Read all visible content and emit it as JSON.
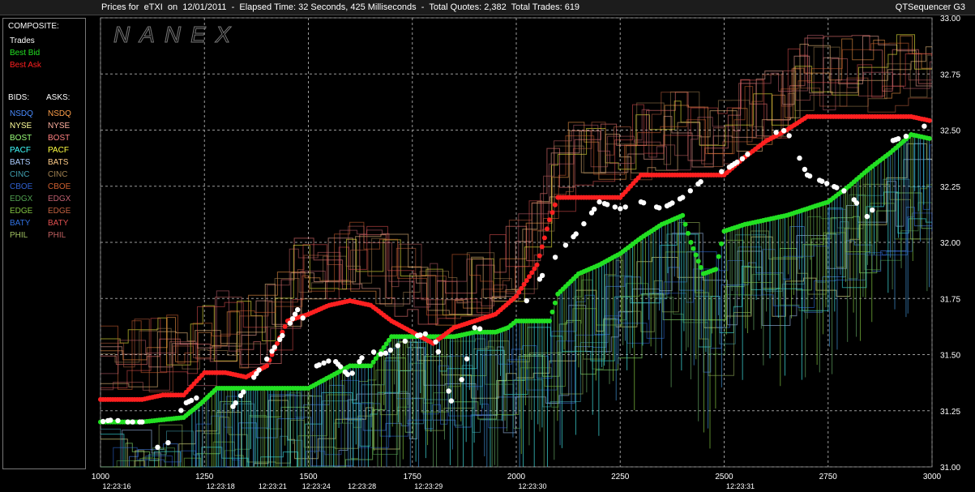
{
  "title": {
    "left": "Prices for  eTXI  on  12/01/2011  -  Elapsed Time: 32 Seconds, 425 Milliseconds  -  Total Quotes: 2,382  Total Trades: 619",
    "right": "QTSequencer G3"
  },
  "watermark": "NANEX",
  "legend": {
    "composite_header": "COMPOSITE:",
    "composite": [
      {
        "label": "Trades",
        "color": "#ffffff"
      },
      {
        "label": "Best Bid",
        "color": "#22e022"
      },
      {
        "label": "Best Ask",
        "color": "#ff2020"
      }
    ],
    "bids_header": "BIDS:",
    "asks_header": "ASKS:",
    "exchanges": [
      {
        "bid": "NSDQ",
        "ask": "NSDQ",
        "bid_color": "#4a8cff",
        "ask_color": "#ff9f4a"
      },
      {
        "bid": "NYSE",
        "ask": "NYSE",
        "bid_color": "#ffff9a",
        "ask_color": "#ffb0a0"
      },
      {
        "bid": "BOST",
        "ask": "BOST",
        "bid_color": "#9aff7a",
        "ask_color": "#ff8080"
      },
      {
        "bid": "PACF",
        "ask": "PACF",
        "bid_color": "#40ffff",
        "ask_color": "#ffff40"
      },
      {
        "bid": "BATS",
        "ask": "BATS",
        "bid_color": "#aaccff",
        "ask_color": "#ffcc88"
      },
      {
        "bid": "CINC",
        "ask": "CINC",
        "bid_color": "#40a0b0",
        "ask_color": "#a08050"
      },
      {
        "bid": "CBOE",
        "ask": "CBOE",
        "bid_color": "#3060d0",
        "ask_color": "#d06030"
      },
      {
        "bid": "EDGX",
        "ask": "EDGX",
        "bid_color": "#50a050",
        "ask_color": "#c06070"
      },
      {
        "bid": "EDGE",
        "ask": "EDGE",
        "bid_color": "#80c040",
        "ask_color": "#c06040"
      },
      {
        "bid": "BATY",
        "ask": "BATY",
        "bid_color": "#3070e0",
        "ask_color": "#e05050"
      },
      {
        "bid": "PHIL",
        "ask": "PHIL",
        "bid_color": "#a0c060",
        "ask_color": "#c06060"
      }
    ]
  },
  "chart_data": {
    "type": "scatter",
    "xlim": [
      1000,
      3000
    ],
    "ylim": [
      31.0,
      33.0
    ],
    "x_ticks": [
      1000,
      1250,
      1500,
      1750,
      2000,
      2250,
      2500,
      2750,
      3000
    ],
    "y_ticks": [
      31.0,
      31.25,
      31.5,
      31.75,
      32.0,
      32.25,
      32.5,
      32.75,
      33.0
    ],
    "y_tick_labels": [
      "31.00",
      "31.25",
      "31.50",
      "31.75",
      "32.00",
      "32.25",
      "32.50",
      "32.75",
      "33.00"
    ],
    "time_labels": [
      {
        "x": 1000,
        "label": "12:23:16"
      },
      {
        "x": 1250,
        "label": "12:23:18"
      },
      {
        "x": 1375,
        "label": "12:23:21"
      },
      {
        "x": 1480,
        "label": "12:23:24"
      },
      {
        "x": 1590,
        "label": "12:23:28"
      },
      {
        "x": 1750,
        "label": "12:23:29"
      },
      {
        "x": 2000,
        "label": "12:23:30"
      },
      {
        "x": 2500,
        "label": "12:23:31"
      }
    ],
    "grid": true,
    "series": [
      {
        "name": "Best Bid",
        "color": "#22e022",
        "points": [
          [
            1000,
            31.2
          ],
          [
            1100,
            31.2
          ],
          [
            1200,
            31.22
          ],
          [
            1240,
            31.28
          ],
          [
            1280,
            31.35
          ],
          [
            1350,
            31.35
          ],
          [
            1400,
            31.35
          ],
          [
            1450,
            31.35
          ],
          [
            1500,
            31.35
          ],
          [
            1550,
            31.4
          ],
          [
            1600,
            31.45
          ],
          [
            1650,
            31.45
          ],
          [
            1700,
            31.58
          ],
          [
            1750,
            31.58
          ],
          [
            1800,
            31.58
          ],
          [
            1850,
            31.58
          ],
          [
            1900,
            31.6
          ],
          [
            1950,
            31.6
          ],
          [
            1980,
            31.62
          ],
          [
            2000,
            31.65
          ],
          [
            2050,
            31.65
          ],
          [
            2080,
            31.65
          ],
          [
            2100,
            31.77
          ],
          [
            2150,
            31.86
          ],
          [
            2200,
            31.9
          ],
          [
            2250,
            31.95
          ],
          [
            2300,
            32.02
          ],
          [
            2350,
            32.08
          ],
          [
            2400,
            32.12
          ],
          [
            2420,
            32.0
          ],
          [
            2450,
            31.86
          ],
          [
            2480,
            31.88
          ],
          [
            2500,
            32.05
          ],
          [
            2550,
            32.08
          ],
          [
            2600,
            32.1
          ],
          [
            2650,
            32.12
          ],
          [
            2700,
            32.15
          ],
          [
            2750,
            32.18
          ],
          [
            2800,
            32.25
          ],
          [
            2850,
            32.33
          ],
          [
            2900,
            32.4
          ],
          [
            2950,
            32.48
          ],
          [
            3000,
            32.46
          ]
        ]
      },
      {
        "name": "Best Ask",
        "color": "#ff2020",
        "points": [
          [
            1000,
            31.3
          ],
          [
            1100,
            31.3
          ],
          [
            1150,
            31.32
          ],
          [
            1200,
            31.32
          ],
          [
            1250,
            31.42
          ],
          [
            1300,
            31.42
          ],
          [
            1350,
            31.4
          ],
          [
            1400,
            31.45
          ],
          [
            1450,
            31.65
          ],
          [
            1500,
            31.68
          ],
          [
            1550,
            31.72
          ],
          [
            1600,
            31.74
          ],
          [
            1650,
            31.72
          ],
          [
            1700,
            31.65
          ],
          [
            1750,
            31.6
          ],
          [
            1800,
            31.55
          ],
          [
            1850,
            31.62
          ],
          [
            1900,
            31.65
          ],
          [
            1950,
            31.68
          ],
          [
            2000,
            31.76
          ],
          [
            2050,
            31.9
          ],
          [
            2080,
            32.1
          ],
          [
            2100,
            32.2
          ],
          [
            2150,
            32.2
          ],
          [
            2200,
            32.2
          ],
          [
            2250,
            32.2
          ],
          [
            2300,
            32.3
          ],
          [
            2350,
            32.3
          ],
          [
            2400,
            32.3
          ],
          [
            2450,
            32.3
          ],
          [
            2500,
            32.3
          ],
          [
            2550,
            32.38
          ],
          [
            2600,
            32.45
          ],
          [
            2650,
            32.5
          ],
          [
            2700,
            32.56
          ],
          [
            2750,
            32.56
          ],
          [
            2800,
            32.56
          ],
          [
            2850,
            32.56
          ],
          [
            2900,
            32.56
          ],
          [
            2950,
            32.56
          ],
          [
            3000,
            32.54
          ]
        ]
      },
      {
        "name": "Trades",
        "color": "#ffffff",
        "points": [
          [
            1000,
            31.2
          ],
          [
            1030,
            31.21
          ],
          [
            1060,
            31.2
          ],
          [
            1100,
            31.2
          ],
          [
            1150,
            31.05
          ],
          [
            1200,
            31.28
          ],
          [
            1280,
            31.35
          ],
          [
            1300,
            31.22
          ],
          [
            1350,
            31.35
          ],
          [
            1400,
            31.48
          ],
          [
            1450,
            31.62
          ],
          [
            1480,
            31.72
          ],
          [
            1500,
            31.55
          ],
          [
            1520,
            31.45
          ],
          [
            1560,
            31.48
          ],
          [
            1600,
            31.4
          ],
          [
            1640,
            31.52
          ],
          [
            1680,
            31.5
          ],
          [
            1750,
            31.58
          ],
          [
            1800,
            31.6
          ],
          [
            1850,
            31.25
          ],
          [
            1900,
            31.62
          ],
          [
            1950,
            31.6
          ],
          [
            2000,
            31.66
          ],
          [
            2050,
            31.82
          ],
          [
            2100,
            31.95
          ],
          [
            2150,
            32.05
          ],
          [
            2200,
            32.18
          ],
          [
            2250,
            32.15
          ],
          [
            2300,
            32.18
          ],
          [
            2350,
            32.15
          ],
          [
            2400,
            32.2
          ],
          [
            2450,
            32.28
          ],
          [
            2500,
            32.32
          ],
          [
            2550,
            32.38
          ],
          [
            2600,
            32.48
          ],
          [
            2650,
            32.5
          ],
          [
            2700,
            32.3
          ],
          [
            2800,
            32.22
          ],
          [
            2850,
            32.1
          ],
          [
            2900,
            32.45
          ],
          [
            2950,
            32.48
          ],
          [
            3000,
            32.54
          ]
        ]
      }
    ]
  }
}
